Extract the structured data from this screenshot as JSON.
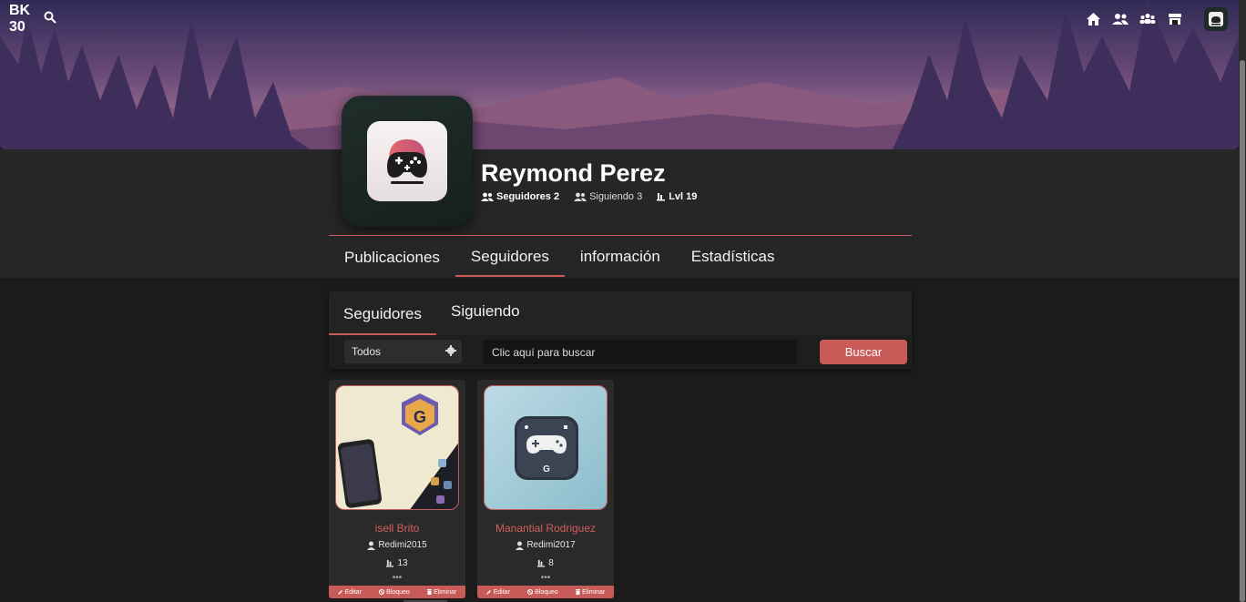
{
  "app": {
    "logo": "BK 30"
  },
  "profile": {
    "name": "Reymond Perez",
    "followers_label": "Seguidores 2",
    "following_label": "Siguiendo 3",
    "level_label": "Lvl 19"
  },
  "main_tabs": [
    {
      "label": "Publicaciones"
    },
    {
      "label": "Seguidores"
    },
    {
      "label": "información"
    },
    {
      "label": "Estadísticas"
    }
  ],
  "sub_tabs": [
    {
      "label": "Seguidores"
    },
    {
      "label": "Siguiendo"
    }
  ],
  "filter": {
    "select_value": "Todos",
    "search_placeholder": "Clic aquí para buscar",
    "search_button": "Buscar"
  },
  "cards": [
    {
      "name": "isell Brito",
      "username": "Redimi2015",
      "level": "13",
      "edit": "Editar",
      "block": "Bloqueo",
      "delete": "Eliminar"
    },
    {
      "name": "Manantial Rodriguez",
      "username": "Redimi2017",
      "level": "8",
      "edit": "Editar",
      "block": "Bloqueo",
      "delete": "Eliminar"
    }
  ],
  "colors": {
    "accent": "#c85a57",
    "background": "#1b1b1b",
    "header": "#262626"
  },
  "icons": [
    "search-icon",
    "home-icon",
    "users-icon",
    "group-icon",
    "store-icon",
    "gamepad-icon",
    "gear-icon",
    "user-icon",
    "level-icon",
    "pencil-icon",
    "ban-icon",
    "trash-icon"
  ]
}
